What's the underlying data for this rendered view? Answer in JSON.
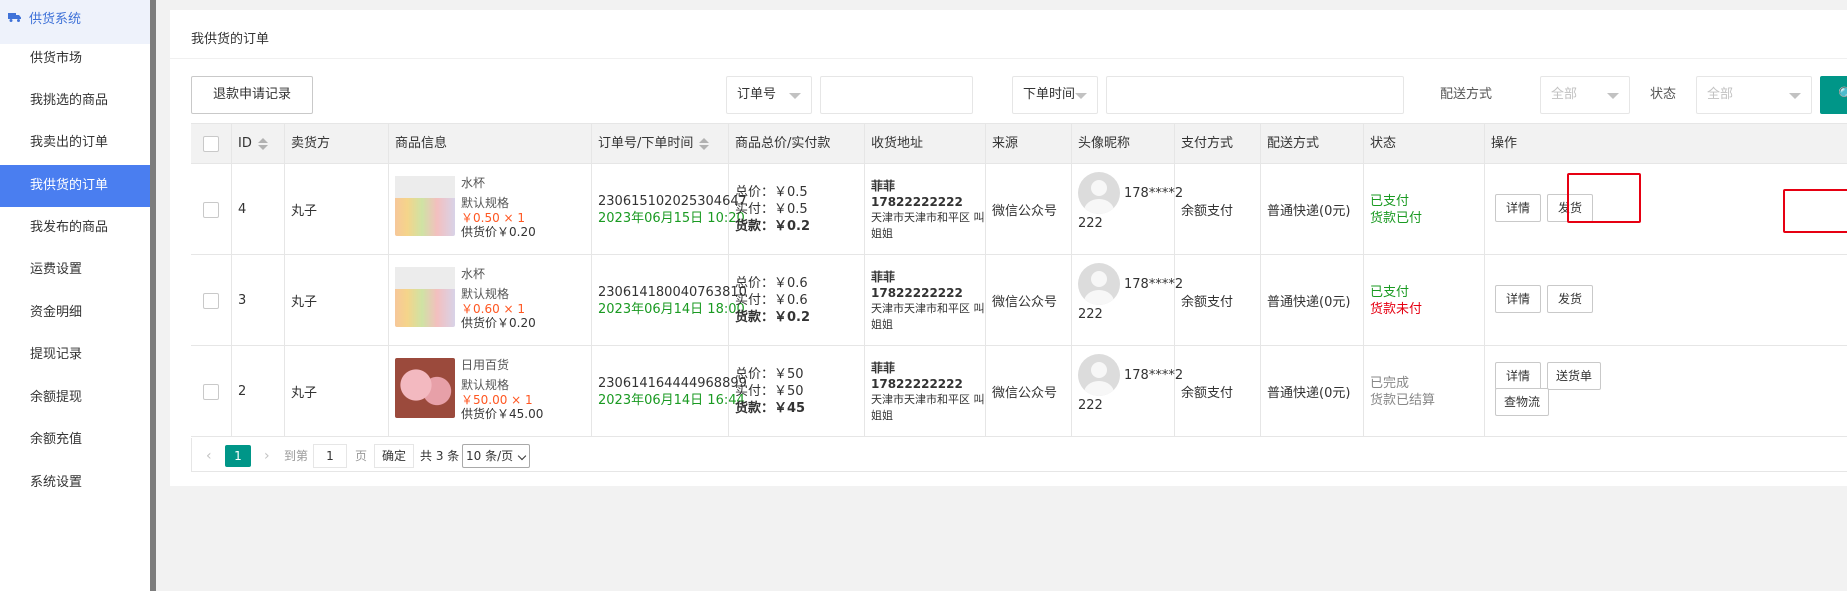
{
  "sidebar": {
    "header": "供货系统",
    "items": [
      {
        "label": "供货市场"
      },
      {
        "label": "我挑选的商品"
      },
      {
        "label": "我卖出的订单"
      },
      {
        "label": "我供货的订单"
      },
      {
        "label": "我发布的商品"
      },
      {
        "label": "运费设置"
      },
      {
        "label": "资金明细"
      },
      {
        "label": "提现记录"
      },
      {
        "label": "余额提现"
      },
      {
        "label": "余额充值"
      },
      {
        "label": "系统设置"
      }
    ],
    "active_index": 3
  },
  "page": {
    "title": "我供货的订单",
    "refund_button": "退款申请记录"
  },
  "filters": {
    "order_no_select": "订单号",
    "time_select": "下单时间",
    "delivery_label": "配送方式",
    "delivery_value": "全部",
    "status_label": "状态",
    "status_value": "全部"
  },
  "colors": {
    "accent": "#4a7ef0",
    "teal": "#009688",
    "price_orange": "#ff5722",
    "green": "#1a9a22",
    "red": "#e60012"
  },
  "table": {
    "headers": [
      "ID",
      "卖货方",
      "商品信息",
      "订单号/下单时间",
      "商品总价/实付款",
      "收货地址",
      "来源",
      "头像昵称",
      "支付方式",
      "配送方式",
      "状态",
      "操作"
    ],
    "rows": [
      {
        "id": "4",
        "seller": "丸子",
        "product": {
          "name": "水杯",
          "spec": "默认规格",
          "price": "￥0.50 × 1",
          "supply": "供货价￥0.20",
          "image": "cups"
        },
        "order_no": "230615102025304647",
        "order_time": "2023年06月15日 10:20",
        "total": "总价：￥0.5",
        "paid": "实付：￥0.5",
        "goods": "货款：￥0.2",
        "addr_name": "菲菲 17822222222",
        "addr_line1": "天津市天津市和平区 叫",
        "addr_line2": "姐姐",
        "source": "微信公众号",
        "nick1": "178****2",
        "nick2": "222",
        "pay": "余额支付",
        "delivery": "普通快递(0元)",
        "status1": "已支付",
        "status2": "货款已付",
        "status1_color": "green",
        "status2_color": "green",
        "ops": [
          "详情",
          "发货"
        ]
      },
      {
        "id": "3",
        "seller": "丸子",
        "product": {
          "name": "水杯",
          "spec": "默认规格",
          "price": "￥0.60 × 1",
          "supply": "供货价￥0.20",
          "image": "cups"
        },
        "order_no": "230614180040763810",
        "order_time": "2023年06月14日 18:00",
        "total": "总价：￥0.6",
        "paid": "实付：￥0.6",
        "goods": "货款：￥0.2",
        "addr_name": "菲菲 17822222222",
        "addr_line1": "天津市天津市和平区 叫",
        "addr_line2": "姐姐",
        "source": "微信公众号",
        "nick1": "178****2",
        "nick2": "222",
        "pay": "余额支付",
        "delivery": "普通快递(0元)",
        "status1": "已支付",
        "status2": "货款未付",
        "status1_color": "green",
        "status2_color": "red",
        "ops": [
          "详情",
          "发货"
        ]
      },
      {
        "id": "2",
        "seller": "丸子",
        "product": {
          "name": "日用百货",
          "spec": "默认规格",
          "price": "￥50.00 × 1",
          "supply": "供货价￥45.00",
          "image": "toys"
        },
        "order_no": "230614164444968899",
        "order_time": "2023年06月14日 16:44",
        "total": "总价：￥50",
        "paid": "实付：￥50",
        "goods": "货款：￥45",
        "addr_name": "菲菲 17822222222",
        "addr_line1": "天津市天津市和平区 叫",
        "addr_line2": "姐姐",
        "source": "微信公众号",
        "nick1": "178****2",
        "nick2": "222",
        "pay": "余额支付",
        "delivery": "普通快递(0元)",
        "status1": "已完成",
        "status2": "货款已结算",
        "status1_color": "gray",
        "status2_color": "gray",
        "ops": [
          "详情",
          "送货单",
          "查物流"
        ]
      }
    ]
  },
  "pagination": {
    "current": "1",
    "goto_label": "到第",
    "goto_value": "1",
    "page_unit": "页",
    "confirm": "确定",
    "total": "共 3 条",
    "page_size": "10 条/页"
  }
}
